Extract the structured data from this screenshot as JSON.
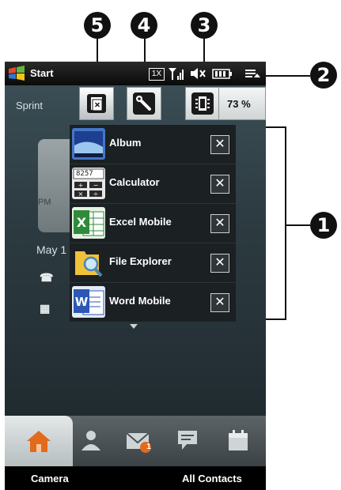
{
  "callouts": {
    "c1": "1",
    "c2": "2",
    "c3": "3",
    "c4": "4",
    "c5": "5"
  },
  "statusbar": {
    "start_label": "Start",
    "icons": [
      "windows-logo-icon",
      "1x-icon",
      "signal-icon",
      "speaker-mute-icon",
      "battery-icon",
      "menu-icon"
    ]
  },
  "home": {
    "carrier": "Sprint",
    "clock_ampm": "PM",
    "date": "May 1"
  },
  "comm_manager": {
    "tabs": [
      "task-manager-tab",
      "settings-tab",
      "battery-tab"
    ],
    "battery_percent": "73 %"
  },
  "tasks": [
    {
      "name": "Album"
    },
    {
      "name": "Calculator",
      "calc_display": "8257"
    },
    {
      "name": "Excel Mobile"
    },
    {
      "name": "File Explorer"
    },
    {
      "name": "Word Mobile"
    }
  ],
  "dock": {
    "items": [
      "home-icon",
      "contacts-icon",
      "messaging-icon",
      "chat-icon",
      "calendar-icon"
    ],
    "badge": "1"
  },
  "softkeys": {
    "left": "Camera",
    "right": "All Contacts"
  },
  "colors": {
    "excel": "#2e8b3a",
    "word": "#2c57b5",
    "home": "#e26a1c"
  }
}
